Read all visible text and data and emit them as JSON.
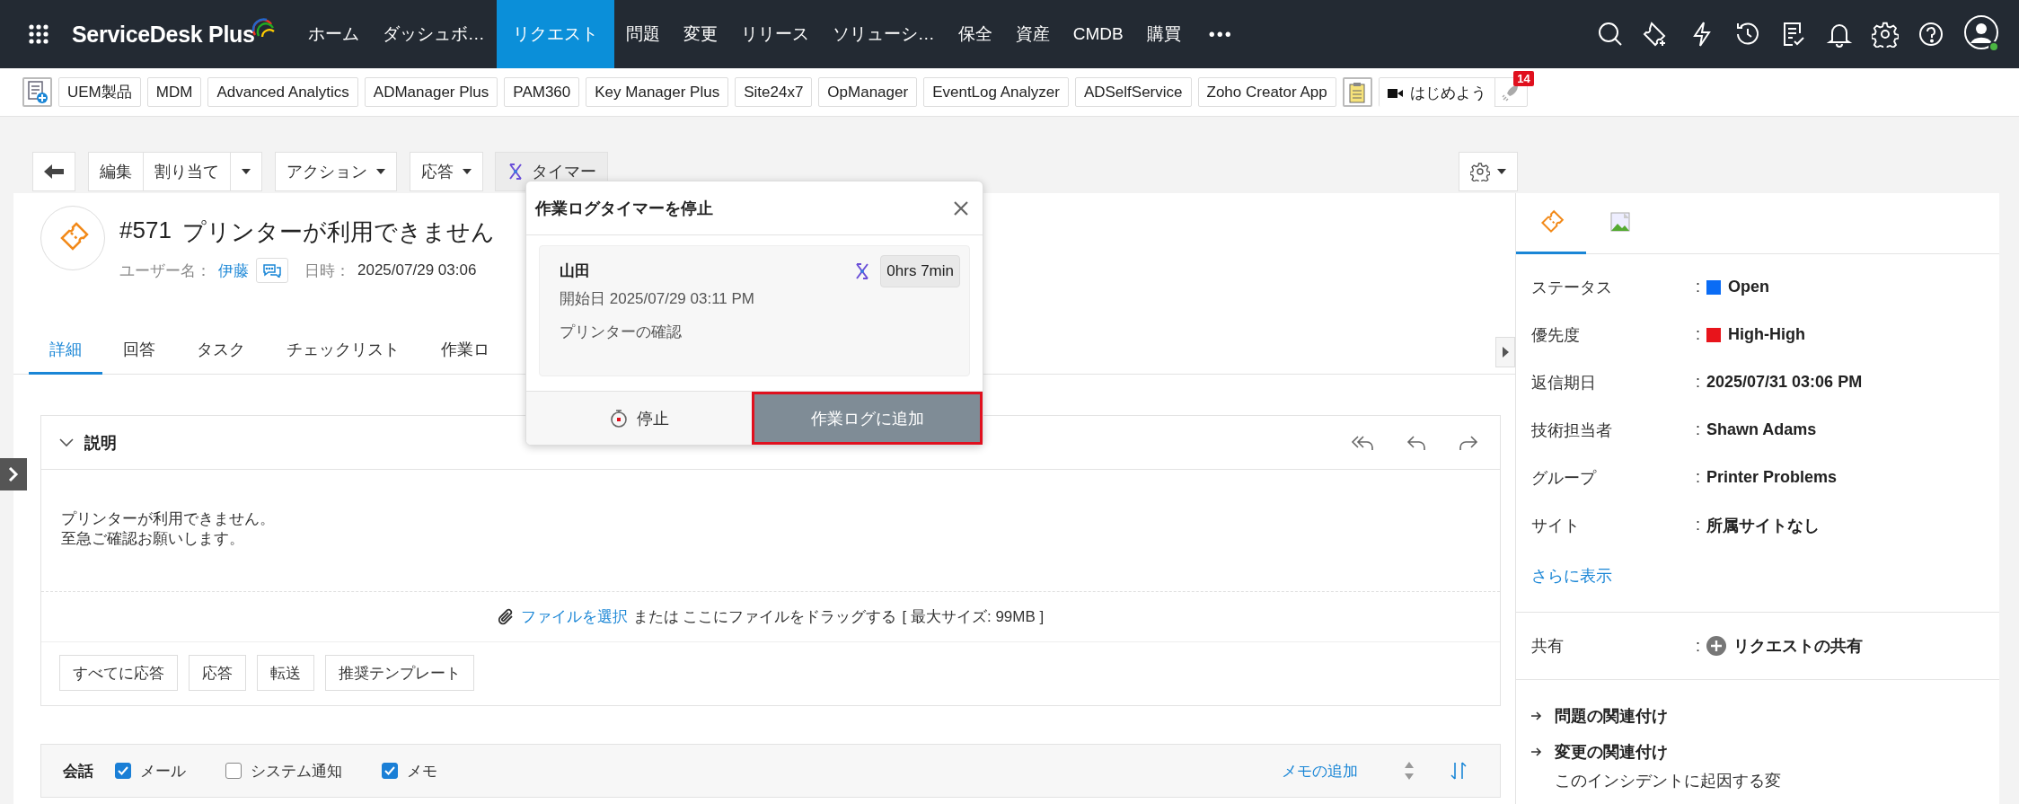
{
  "top_nav": {
    "logo": "ServiceDesk Plus",
    "items": [
      {
        "label": "ホーム",
        "selected": false
      },
      {
        "label": "ダッシュボ…",
        "selected": false
      },
      {
        "label": "リクエスト",
        "selected": true
      },
      {
        "label": "問題",
        "selected": false
      },
      {
        "label": "変更",
        "selected": false
      },
      {
        "label": "リリース",
        "selected": false
      },
      {
        "label": "ソリューシ…",
        "selected": false
      },
      {
        "label": "保全",
        "selected": false
      },
      {
        "label": "資産",
        "selected": false
      },
      {
        "label": "CMDB",
        "selected": false
      },
      {
        "label": "購買",
        "selected": false
      }
    ],
    "more": "•••"
  },
  "product_bar": {
    "items": [
      "UEM製品",
      "MDM",
      "Advanced Analytics",
      "ADManager Plus",
      "PAM360",
      "Key Manager Plus",
      "Site24x7",
      "OpManager",
      "EventLog Analyzer",
      "ADSelfService",
      "Zoho Creator App"
    ],
    "meeting": "はじめよう",
    "badge": "14"
  },
  "toolbar": {
    "edit": "編集",
    "assign": "割り当て",
    "actions": "アクション",
    "reply": "応答",
    "timer": "タイマー"
  },
  "request": {
    "number": "#571",
    "title": "プリンターが利用できません",
    "user_label": "ユーザー名：",
    "user": "伊藤",
    "date_label": "日時：",
    "date": "2025/07/29 03:06"
  },
  "tabs": [
    {
      "label": "詳細",
      "selected": true
    },
    {
      "label": "回答",
      "selected": false
    },
    {
      "label": "タスク",
      "selected": false
    },
    {
      "label": "チェックリスト",
      "selected": false
    },
    {
      "label": "作業ロ",
      "selected": false
    }
  ],
  "description": {
    "title": "説明",
    "lines": [
      "プリンターが利用できません。",
      "至急ご確認お願いします。"
    ]
  },
  "attachment": {
    "link": "ファイルを選択",
    "text": "または ここにファイルをドラッグする",
    "limit": "[ 最大サイズ: 99MB ]"
  },
  "reply_buttons": [
    "すべてに応答",
    "応答",
    "転送",
    "推奨テンプレート"
  ],
  "conversation": {
    "title": "会話",
    "filters": [
      {
        "label": "メール",
        "checked": true
      },
      {
        "label": "システム通知",
        "checked": false
      },
      {
        "label": "メモ",
        "checked": true
      }
    ],
    "add_note": "メモの追加"
  },
  "popup": {
    "title": "作業ログタイマーを停止",
    "technician": "山田",
    "elapsed": "0hrs 7min",
    "start": "開始日 2025/07/29 03:11 PM",
    "task": "プリンターの確認",
    "stop": "停止",
    "add": "作業ログに追加",
    "add_highlighted": true
  },
  "details": {
    "tabs": [
      {
        "kind": "ticket",
        "selected": true
      },
      {
        "kind": "image",
        "selected": false
      }
    ],
    "fields": [
      {
        "label": "ステータス",
        "colon": ":",
        "value": "Open",
        "color": "#0a6cf5"
      },
      {
        "label": "優先度",
        "colon": ":",
        "value": "High-High",
        "color": "#e8141b"
      },
      {
        "label": "返信期日",
        "colon": ":",
        "value": "2025/07/31 03:06 PM"
      },
      {
        "label": "技術担当者",
        "colon": ":",
        "value": "Shawn Adams"
      },
      {
        "label": "グループ",
        "colon": ":",
        "value": "Printer Problems"
      },
      {
        "label": "サイト",
        "colon": ":",
        "value": "所属サイトなし"
      }
    ],
    "more": "さらに表示",
    "share_label": "共有",
    "share_colon": ":",
    "share": "リクエストの共有",
    "links": [
      {
        "label": "問題の関連付け"
      },
      {
        "label": "変更の関連付け",
        "note": "このインシデントに起因する変"
      }
    ]
  }
}
